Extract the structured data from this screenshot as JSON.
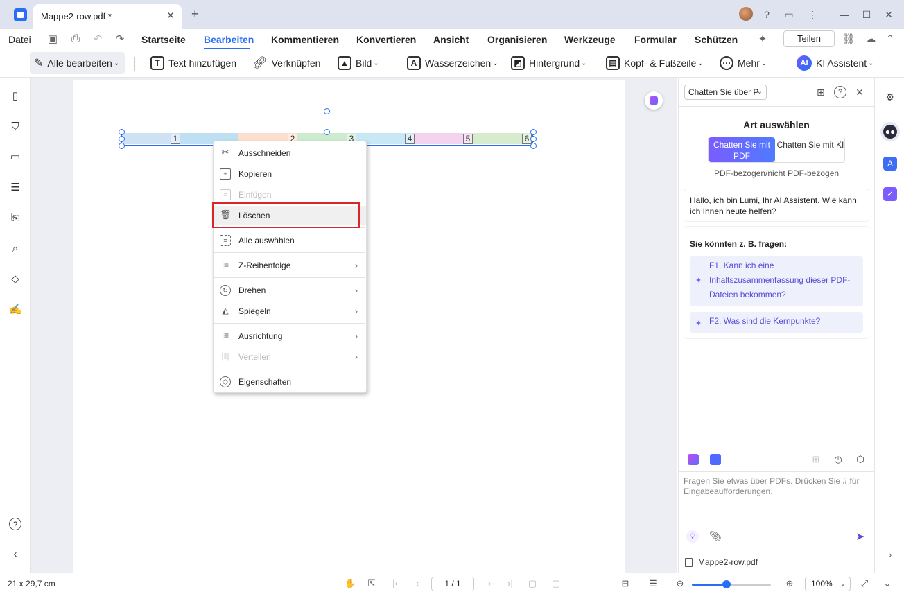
{
  "titlebar": {
    "tab_title": "Mappe2-row.pdf *",
    "close": "✕",
    "new_tab": "+"
  },
  "menubar": {
    "file": "Datei",
    "items": [
      "Startseite",
      "Bearbeiten",
      "Kommentieren",
      "Konvertieren",
      "Ansicht",
      "Organisieren",
      "Werkzeuge",
      "Formular",
      "Schützen"
    ],
    "active": "Bearbeiten",
    "share": "Teilen"
  },
  "toolbar": {
    "edit_all": "Alle bearbeiten",
    "add_text": "Text hinzufügen",
    "link": "Verknüpfen",
    "image": "Bild",
    "watermark": "Wasserzeichen",
    "background": "Hintergrund",
    "header_footer": "Kopf- & Fußzeile",
    "more": "Mehr",
    "ai": "KI Assistent",
    "ai_badge": "AI"
  },
  "table_row": {
    "cells": [
      "1",
      "2",
      "3",
      "4",
      "5",
      "6"
    ],
    "colors": [
      "#cfe2f3",
      "#bfe0f2",
      "#fbe0d0",
      "#cdebcf",
      "#c9e8f5",
      "#f3d3ee",
      "#d6eccc"
    ]
  },
  "context_menu": {
    "cut": "Ausschneiden",
    "copy": "Kopieren",
    "paste": "Einfügen",
    "delete": "Löschen",
    "select_all": "Alle auswählen",
    "z_order": "Z-Reihenfolge",
    "rotate": "Drehen",
    "mirror": "Spiegeln",
    "align": "Ausrichtung",
    "distribute": "Verteilen",
    "properties": "Eigenschaften",
    "submenu_arrow": "›",
    "highlight_color": "#d8262b"
  },
  "ai_panel": {
    "mode_select": "Chatten Sie über P",
    "art_title": "Art auswählen",
    "seg_pdf": "Chatten Sie mit PDF",
    "seg_ki": "Chatten Sie mit KI",
    "pdf_sub": "PDF-bezogen/nicht PDF-bezogen",
    "greeting": "Hallo, ich bin Lumi, Ihr AI Assistent. Wie kann ich Ihnen heute helfen?",
    "suggest_title": "Sie könnten z. B. fragen:",
    "q1": "F1. Kann ich eine Inhaltszusammenfassung dieser PDF-Dateien bekommen?",
    "q2": "F2. Was sind die Kernpunkte?",
    "input_placeholder": "Fragen Sie etwas über PDFs. Drücken Sie # für Eingabeaufforderungen.",
    "file_name": "Mappe2-row.pdf",
    "accent": "#6a5cff"
  },
  "statusbar": {
    "page_size": "21 x 29,7 cm",
    "page_indicator": "1 / 1",
    "zoom": "100%",
    "zoom_fraction": 0.44
  }
}
